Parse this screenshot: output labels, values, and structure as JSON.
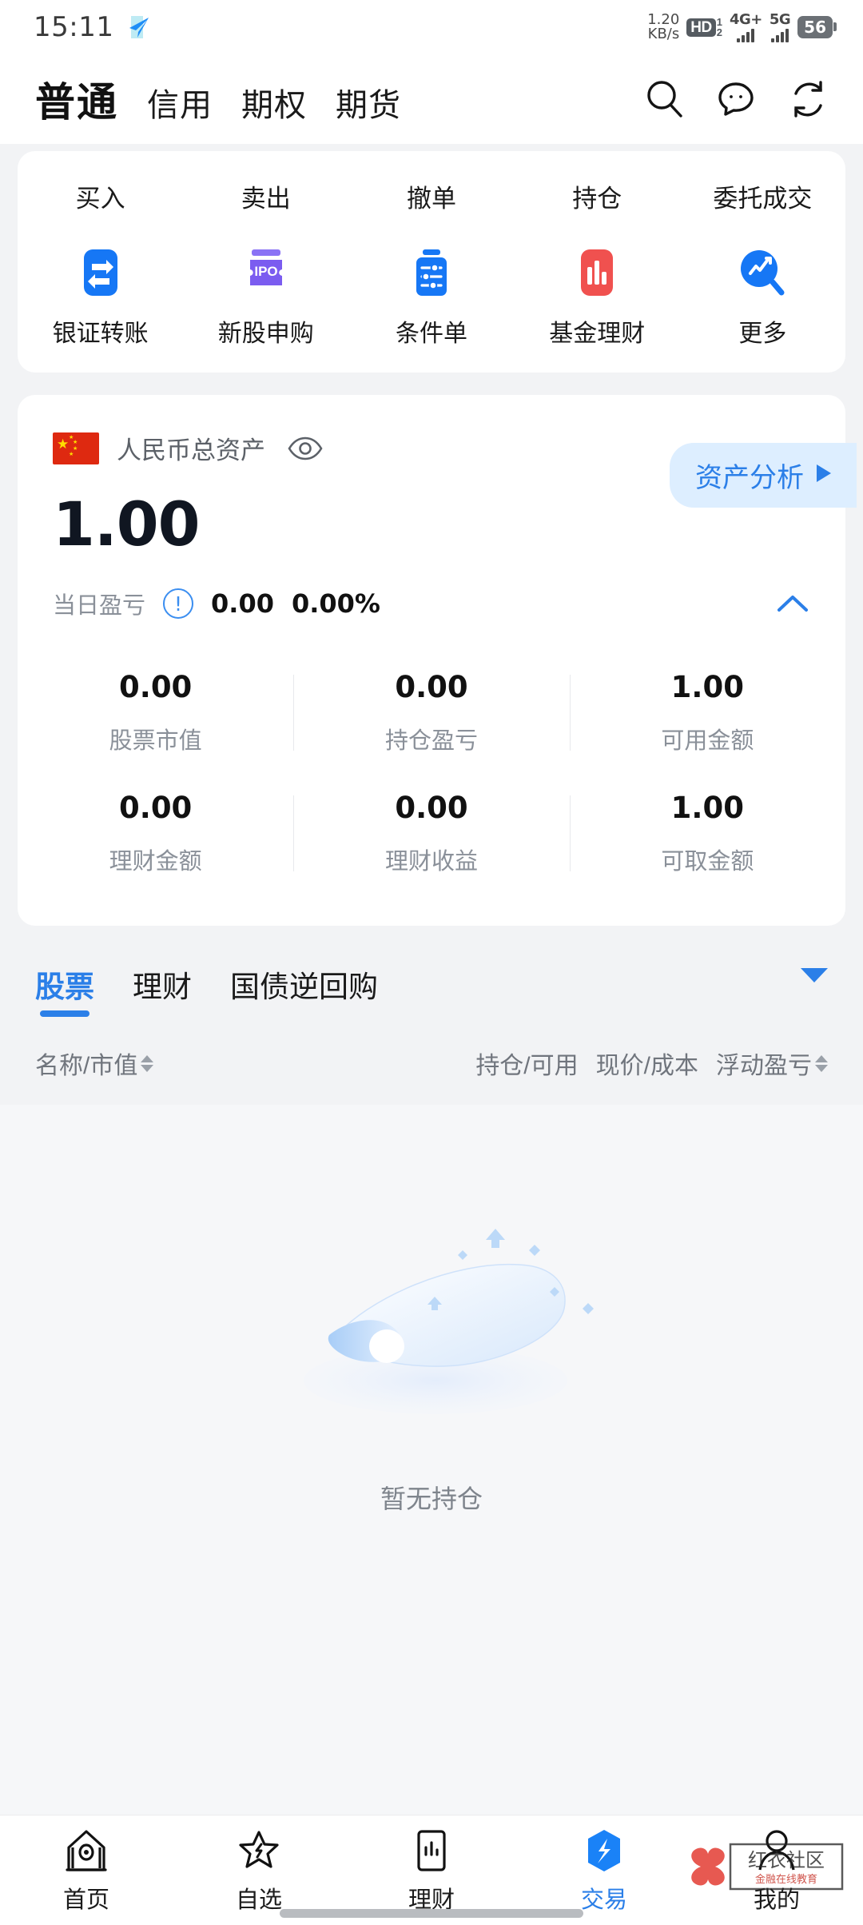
{
  "status_bar": {
    "time": "15:11",
    "app_icon": "telegram-icon",
    "net_speed_value": "1.20",
    "net_speed_unit": "KB/s",
    "hd_label": "HD",
    "hd_sim_top": "1",
    "hd_sim_bottom": "2",
    "signal1_label": "4G+",
    "signal2_label": "5G",
    "battery": "56"
  },
  "header": {
    "tabs": [
      {
        "label": "普通",
        "active": true
      },
      {
        "label": "信用",
        "active": false
      },
      {
        "label": "期权",
        "active": false
      },
      {
        "label": "期货",
        "active": false
      }
    ],
    "icons": [
      "search-icon",
      "chat-icon",
      "refresh-icon"
    ]
  },
  "action_card": {
    "text_actions": [
      "买入",
      "卖出",
      "撤单",
      "持仓",
      "委托成交"
    ],
    "icon_actions": [
      {
        "label": "银证转账",
        "icon": "transfer-icon",
        "color": "#1677f5"
      },
      {
        "label": "新股申购",
        "icon": "ipo-icon",
        "color": "#7b5cf0"
      },
      {
        "label": "条件单",
        "icon": "condition-order-icon",
        "color": "#1677f5"
      },
      {
        "label": "基金理财",
        "icon": "fund-chart-icon",
        "color": "#f0514f"
      },
      {
        "label": "更多",
        "icon": "more-search-icon",
        "color": "#1677f5"
      }
    ]
  },
  "asset_card": {
    "flag": "cn-flag-icon",
    "title": "人民币总资产",
    "eye_icon": "eye-icon",
    "analysis_button": "资产分析",
    "balance": "1.00",
    "pl_label": "当日盈亏",
    "info_icon": "info-icon",
    "pl_amount": "0.00",
    "pl_percent": "0.00%",
    "collapse_icon": "chevron-up-icon",
    "stats_rows": [
      [
        {
          "value": "0.00",
          "label": "股票市值"
        },
        {
          "value": "0.00",
          "label": "持仓盈亏"
        },
        {
          "value": "1.00",
          "label": "可用金额"
        }
      ],
      [
        {
          "value": "0.00",
          "label": "理财金额"
        },
        {
          "value": "0.00",
          "label": "理财收益"
        },
        {
          "value": "1.00",
          "label": "可取金额"
        }
      ]
    ]
  },
  "positions": {
    "tabs": [
      {
        "label": "股票",
        "active": true
      },
      {
        "label": "理财",
        "active": false
      },
      {
        "label": "国债逆回购",
        "active": false
      }
    ],
    "dropdown_icon": "triangle-down-icon",
    "columns": {
      "name_value": "名称/市值",
      "hold_available": "持仓/可用",
      "price_cost": "现价/成本",
      "float_pl": "浮动盈亏"
    },
    "empty_text": "暂无持仓",
    "empty_illustration": "empty-scroll-icon"
  },
  "bottom_nav": {
    "items": [
      {
        "label": "首页",
        "icon": "home-icon",
        "active": false
      },
      {
        "label": "自选",
        "icon": "star-icon",
        "active": false
      },
      {
        "label": "理财",
        "icon": "finance-chart-icon",
        "active": false
      },
      {
        "label": "交易",
        "icon": "trade-hexagon-icon",
        "active": true
      },
      {
        "label": "我的",
        "icon": "profile-icon",
        "active": false
      }
    ],
    "watermark": "红衣社区 金融在线教育"
  },
  "colors": {
    "accent_blue": "#2b7fe8",
    "brand_blue": "#1677f5",
    "red": "#f0514f",
    "purple": "#7b5cf0",
    "flag_red": "#de2910"
  }
}
